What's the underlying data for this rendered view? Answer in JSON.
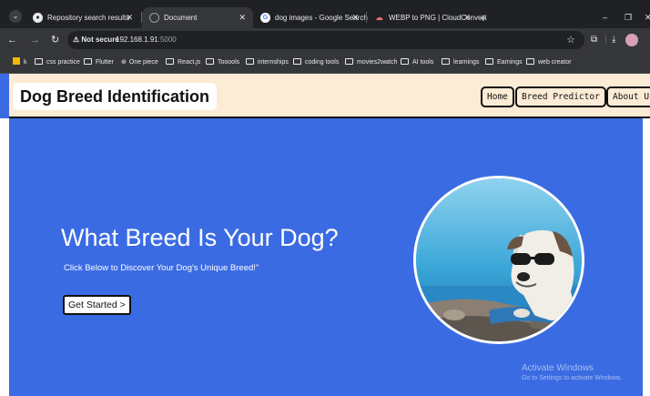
{
  "browser": {
    "tabs": [
      {
        "title": "Repository search results",
        "icon": "github-icon"
      },
      {
        "title": "Document",
        "icon": "globe-icon"
      },
      {
        "title": "dog images - Google Search",
        "icon": "google-icon"
      },
      {
        "title": "WEBP to PNG | CloudConvert",
        "icon": "cloud-icon"
      }
    ],
    "close_glyph": "✕",
    "new_tab_glyph": "+",
    "security_label": "Not secure",
    "url_host": "192.168.1.91",
    "url_port": ":5000",
    "bookmarks": [
      {
        "label": "k",
        "kind": "app"
      },
      {
        "label": "css practice",
        "kind": "folder"
      },
      {
        "label": "Flutter",
        "kind": "folder"
      },
      {
        "label": "One piece",
        "kind": "link"
      },
      {
        "label": "React.js",
        "kind": "folder"
      },
      {
        "label": "Tooools",
        "kind": "folder"
      },
      {
        "label": "internships",
        "kind": "folder"
      },
      {
        "label": "coding tools",
        "kind": "folder"
      },
      {
        "label": "movies2watch",
        "kind": "folder"
      },
      {
        "label": "AI tools",
        "kind": "folder"
      },
      {
        "label": "learnings",
        "kind": "folder"
      },
      {
        "label": "Earnings",
        "kind": "folder"
      },
      {
        "label": "web creator",
        "kind": "folder"
      }
    ]
  },
  "site": {
    "brand": "Dog Breed Identification",
    "nav": [
      {
        "label": "Home"
      },
      {
        "label": "Breed Predictor"
      },
      {
        "label": "About Us"
      }
    ],
    "hero": {
      "headline": "What Breed Is Your Dog?",
      "subline": "Click Below to Discover Your Dog's Unique Breed!\"",
      "cta_label": "Get Started >"
    }
  },
  "watermark": {
    "title": "Activate Windows",
    "subtitle": "Go to Settings to activate Windows."
  },
  "colors": {
    "hero_bg": "#3b6be3",
    "navbar_bg": "#fcebd5",
    "browser_dark": "#202124",
    "browser_toolbar": "#35363a"
  }
}
